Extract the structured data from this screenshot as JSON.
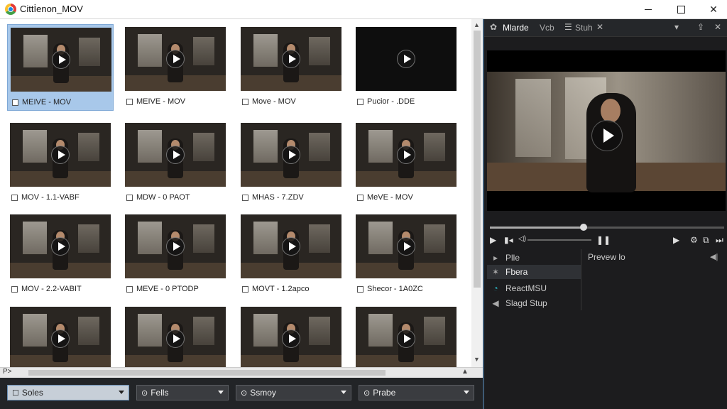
{
  "window": {
    "title": "Cittİenon_MOV"
  },
  "grid": {
    "tiles": [
      {
        "label": "MEIVE - MOV",
        "selected": true,
        "dark": false
      },
      {
        "label": "MEIVE - MOV",
        "selected": false,
        "dark": false
      },
      {
        "label": "Move - MOV",
        "selected": false,
        "dark": false
      },
      {
        "label": "Pucior - .DDE",
        "selected": false,
        "dark": true
      },
      {
        "label": "MOV - 1.1-VABF",
        "selected": false,
        "dark": false
      },
      {
        "label": "MDW - 0 PAOT",
        "selected": false,
        "dark": false
      },
      {
        "label": "MHAS - 7.ZDV",
        "selected": false,
        "dark": false
      },
      {
        "label": "MeVE - MOV",
        "selected": false,
        "dark": false
      },
      {
        "label": "MOV - 2.2-VABIT",
        "selected": false,
        "dark": false
      },
      {
        "label": "MEVE - 0 PTODP",
        "selected": false,
        "dark": false
      },
      {
        "label": "MOVT - 1.2apco",
        "selected": false,
        "dark": false
      },
      {
        "label": "Shecor - 1A0ZC",
        "selected": false,
        "dark": false
      },
      {
        "label": "",
        "selected": false,
        "dark": false
      },
      {
        "label": "",
        "selected": false,
        "dark": false
      },
      {
        "label": "",
        "selected": false,
        "dark": false
      },
      {
        "label": "",
        "selected": false,
        "dark": false
      }
    ]
  },
  "hscroll": {
    "label": "P>"
  },
  "toolbar": {
    "dropdowns": [
      {
        "label": "Soles",
        "icon": ""
      },
      {
        "label": "Fells",
        "icon": "⊙"
      },
      {
        "label": "Ssmoy",
        "icon": "⊙"
      },
      {
        "label": "Prabe",
        "icon": "⊙"
      }
    ]
  },
  "right": {
    "tabs": [
      "Mlarde",
      "Vcb",
      "Stuh"
    ],
    "menu": [
      {
        "label": "Plle",
        "icon": "▸"
      },
      {
        "label": "Fbera",
        "icon": "✶"
      },
      {
        "label": "ReactMSU",
        "icon": "◔"
      },
      {
        "label": "Slagd Stup",
        "icon": "◀"
      }
    ],
    "preview_label": "Prevew lo",
    "seek_progress": 0.4
  },
  "colors": {
    "selection": "#a8c8ea",
    "accent": "#3e5a74",
    "teal": "#2bb3c0"
  }
}
